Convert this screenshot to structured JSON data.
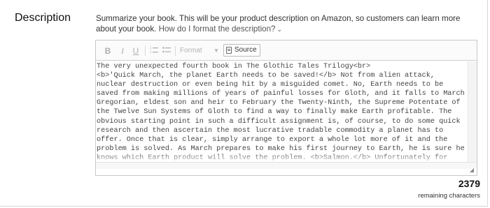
{
  "section": {
    "title": "Description"
  },
  "help": {
    "text": "Summarize your book. This will be your product description on Amazon, so customers can learn more about your book. ",
    "link": "How do I format the description?"
  },
  "toolbar": {
    "bold_label": "B",
    "italic_label": "I",
    "underline_label": "U",
    "format_label": "Format",
    "source_label": "Source"
  },
  "editor": {
    "content": "The very unexpected fourth book in The Glothic Tales Trilogy<br>\n<b>'Quick March, the planet Earth needs to be saved!</b> Not from alien attack, nuclear destruction or even being hit by a misguided comet. No, Earth needs to be saved from making millions of years of painful losses for Gloth, and it falls to March Gregorian, eldest son and heir to February the Twenty-Ninth, the Supreme Potentate of the Twelve Sun Systems of Gloth to find a way to finally make Earth profitable. The obvious starting point in such a difficult assignment is, of course, to do some quick research and then ascertain the most lucrative tradable commodity a planet has to offer. Once that is clear, simply arrange to export a whole lot more of it and the problem is solved. As March prepares to make his first journey to Earth, he is sure he knows which Earth product will solve the problem. <b>Salmon.</b> Unfortunately for March, all does not go well on the Salmon front, and he discovers all too quickly that Earth is"
  },
  "counter": {
    "value": "2379",
    "label": "remaining characters"
  }
}
